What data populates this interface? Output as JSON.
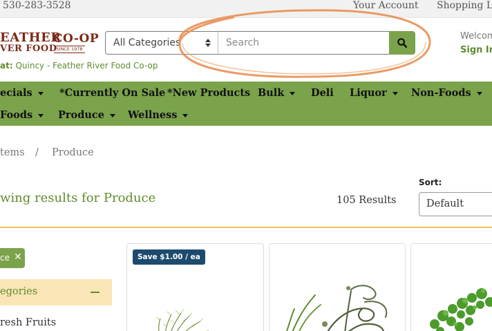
{
  "topbar": {
    "phone": "530-283-3528",
    "account": "Your Account",
    "shopping": "Shopping Li"
  },
  "logo": {
    "line1": "EATHER",
    "line2": "VER FOOD",
    "coop": "CO-OP",
    "since": "SINCE 1978"
  },
  "store": {
    "prefix": "at:",
    "name": "Quincy - Feather River Food Co-op"
  },
  "search": {
    "category": "All Categories",
    "placeholder": "Search",
    "button_icon": "search-icon"
  },
  "user": {
    "welcome": "Welcom",
    "sign_in": "Sign In"
  },
  "annotation_color": "#e8894a",
  "nav": {
    "row1": [
      {
        "label": "ecials",
        "dropdown": true
      },
      {
        "label": "*Currently On Sale",
        "dropdown": false
      },
      {
        "label": "*New Products",
        "dropdown": false
      },
      {
        "label": "Bulk",
        "dropdown": true
      },
      {
        "label": "Deli",
        "dropdown": false
      },
      {
        "label": "Liquor",
        "dropdown": true
      },
      {
        "label": "Non-Foods",
        "dropdown": true
      }
    ],
    "row2": [
      {
        "label": "Foods",
        "dropdown": true
      },
      {
        "label": "Produce",
        "dropdown": true
      },
      {
        "label": "Wellness",
        "dropdown": true
      }
    ]
  },
  "breadcrumb": {
    "items": "tems",
    "separator": "/",
    "current": "Produce"
  },
  "results": {
    "title": "wing results for Produce",
    "count": "105 Results"
  },
  "sort": {
    "label": "Sort:",
    "value": "Default"
  },
  "sidebar": {
    "chip": "ce",
    "chip_close": "✕",
    "categories_title": "egories",
    "first_category": "resh Fruits"
  },
  "products": [
    {
      "badge": "Save $1.00 / ea"
    },
    {
      "badge": ""
    },
    {
      "badge": ""
    }
  ],
  "colors": {
    "brand_green": "#7aa34b",
    "text_green": "#5f8b2d",
    "badge_blue": "#1d4b6e",
    "accent_yellow": "#efc25c",
    "logo_brown": "#7a2a17"
  }
}
